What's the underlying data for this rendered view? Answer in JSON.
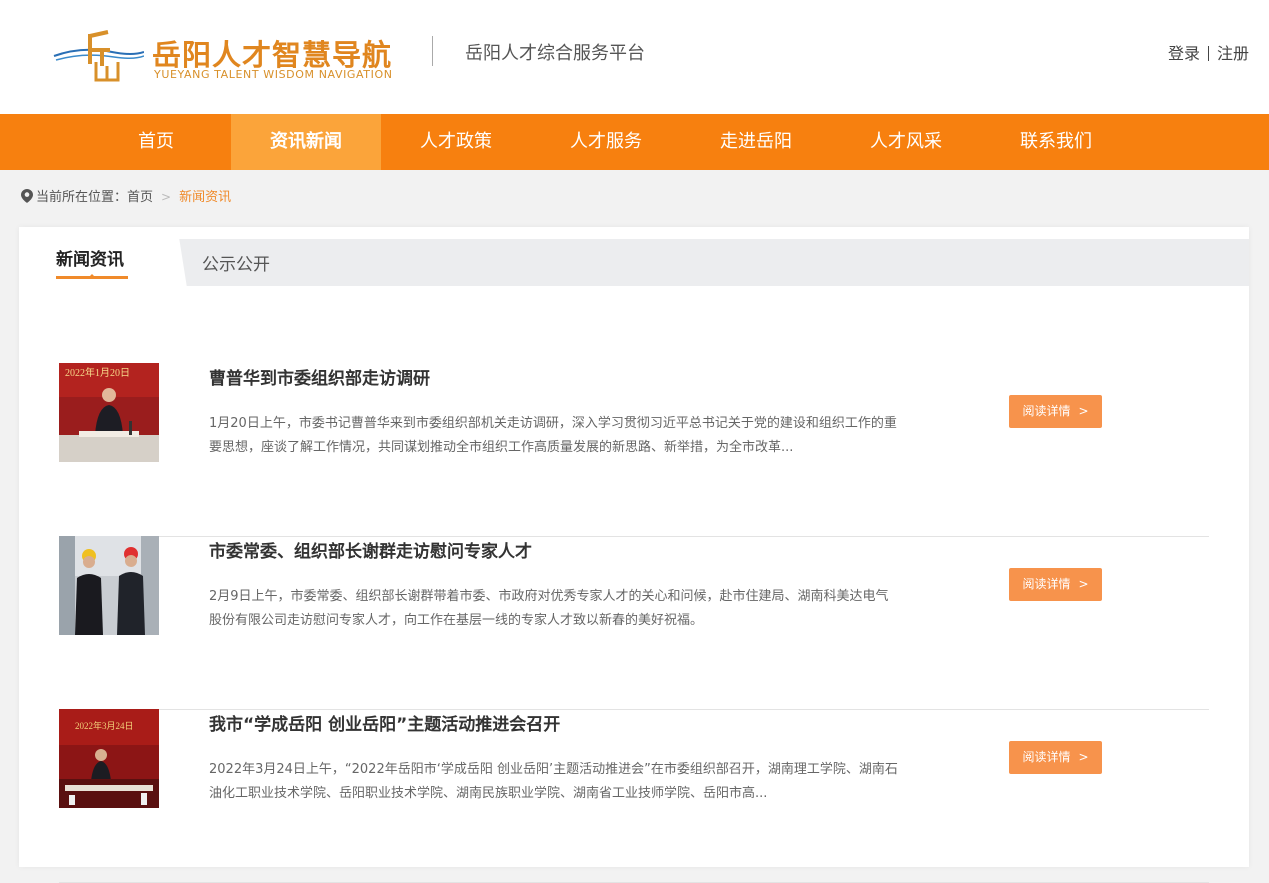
{
  "header": {
    "logo_cn": "岳阳人才智慧导航",
    "logo_en": "YUEYANG TALENT WISDOM NAVIGATION",
    "platform": "岳阳人才综合服务平台",
    "login": "登录",
    "register": "注册"
  },
  "nav": {
    "items": [
      {
        "label": "首页"
      },
      {
        "label": "资讯新闻",
        "active": true
      },
      {
        "label": "人才政策"
      },
      {
        "label": "人才服务"
      },
      {
        "label": "走进岳阳"
      },
      {
        "label": "人才风采"
      },
      {
        "label": "联系我们"
      }
    ]
  },
  "breadcrumb": {
    "prefix": "当前所在位置：",
    "home": "首页",
    "current": "新闻资讯"
  },
  "tabs": {
    "active": "新闻资讯",
    "other": "公示公开"
  },
  "news": [
    {
      "title": "曹普华到市委组织部走访调研",
      "summary": "1月20日上午，市委书记曹普华来到市委组织部机关走访调研，深入学习贯彻习近平总书记关于党的建设和组织工作的重要思想，座谈了解工作情况，共同谋划推动全市组织工作高质量发展的新思路、新举措，为全市改革...",
      "thumb_caption": "2022年1月20日",
      "button": "阅读详情"
    },
    {
      "title": "市委常委、组织部长谢群走访慰问专家人才",
      "summary": "2月9日上午，市委常委、组织部长谢群带着市委、市政府对优秀专家人才的关心和问候，赴市住建局、湖南科美达电气股份有限公司走访慰问专家人才，向工作在基层一线的专家人才致以新春的美好祝福。",
      "thumb_caption": "",
      "button": "阅读详情"
    },
    {
      "title": "我市“学成岳阳 创业岳阳”主题活动推进会召开",
      "summary": "2022年3月24日上午，“2022年岳阳市‘学成岳阳 创业岳阳’主题活动推进会”在市委组织部召开，湖南理工学院、湖南石油化工职业技术学院、岳阳职业技术学院、湖南民族职业学院、湖南省工业技师学院、岳阳市高...",
      "thumb_caption": "2022年3月24日",
      "button": "阅读详情"
    }
  ]
}
